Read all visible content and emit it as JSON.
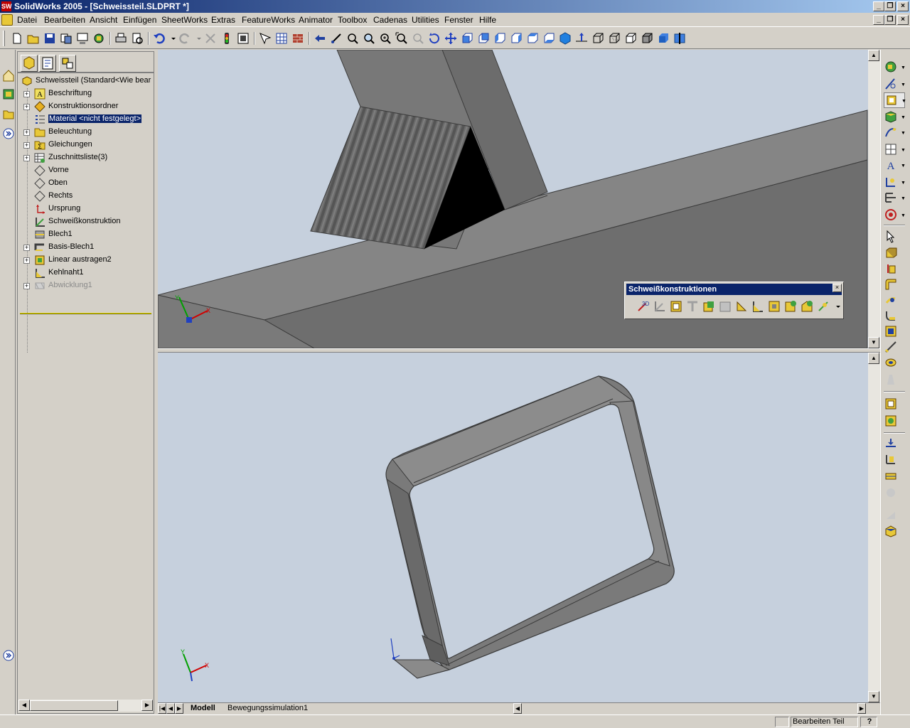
{
  "window": {
    "title": "SolidWorks 2005 - [Schweissteil.SLDPRT *]",
    "app_icon_text": "SW"
  },
  "menu": [
    "Datei",
    "Bearbeiten",
    "Ansicht",
    "Einfügen",
    "SheetWorks",
    "Extras",
    "FeatureWorks",
    "Animator",
    "Toolbox",
    "Cadenas",
    "Utilities",
    "Fenster",
    "Hilfe"
  ],
  "feature_tree": {
    "root": "Schweissteil  (Standard<Wie bear",
    "items": [
      {
        "label": "Beschriftung",
        "icon": "annotations-icon",
        "expandable": true
      },
      {
        "label": "Konstruktionsordner",
        "icon": "design-binder-icon",
        "expandable": true
      },
      {
        "label": "Material <nicht festgelegt>",
        "icon": "material-icon",
        "expandable": false,
        "selected": true
      },
      {
        "label": "Beleuchtung",
        "icon": "lighting-icon",
        "expandable": true
      },
      {
        "label": "Gleichungen",
        "icon": "equations-icon",
        "expandable": true
      },
      {
        "label": "Zuschnittsliste(3)",
        "icon": "cut-list-icon",
        "expandable": true
      },
      {
        "label": "Vorne",
        "icon": "plane-icon",
        "expandable": false
      },
      {
        "label": "Oben",
        "icon": "plane-icon",
        "expandable": false
      },
      {
        "label": "Rechts",
        "icon": "plane-icon",
        "expandable": false
      },
      {
        "label": "Ursprung",
        "icon": "origin-icon",
        "expandable": false
      },
      {
        "label": "Schweißkonstruktion",
        "icon": "weldment-icon",
        "expandable": false
      },
      {
        "label": "Blech1",
        "icon": "sheet-metal-icon",
        "expandable": false
      },
      {
        "label": "Basis-Blech1",
        "icon": "base-flange-icon",
        "expandable": true
      },
      {
        "label": "Linear austragen2",
        "icon": "extrude-icon",
        "expandable": true
      },
      {
        "label": "Kehlnaht1",
        "icon": "fillet-bead-icon",
        "expandable": false
      },
      {
        "label": "Abwicklung1",
        "icon": "flatten-icon",
        "expandable": true,
        "suppressed": true
      }
    ]
  },
  "weldment_toolbar": {
    "title": "Schweißkonstruktionen",
    "buttons": [
      "3d-sketch-icon",
      "weldment-icon",
      "structural-member-icon",
      "trim-extend-icon",
      "extruded-boss-icon",
      "extruded-cut-icon",
      "gusset-icon",
      "end-cap-icon",
      "fillet-bead-icon",
      "weldment-cut-list-icon",
      "insert-part-icon",
      "reference-geometry-icon"
    ]
  },
  "bottom_tabs": [
    "Modell",
    "Bewegungssimulation1"
  ],
  "status": {
    "mode": "Bearbeiten Teil",
    "help": "?"
  },
  "colors": {
    "titlebar": "#0a246a",
    "viewport_bg": "#c6d0dd",
    "steel": "#7c7c7c",
    "selection": "#0a246a"
  }
}
